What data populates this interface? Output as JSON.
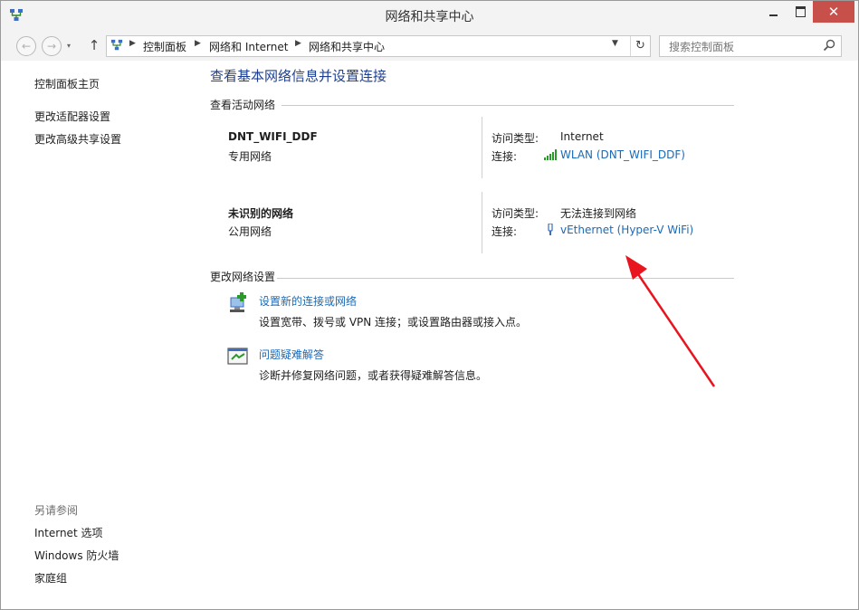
{
  "window": {
    "title": "网络和共享中心",
    "close_glyph": "✕"
  },
  "nav": {
    "back_glyph": "←",
    "forward_glyph": "→",
    "up_glyph": "↑",
    "breadcrumbs": [
      "控制面板",
      "网络和 Internet",
      "网络和共享中心"
    ],
    "search_placeholder": "搜索控制面板"
  },
  "sidebar": {
    "home": "控制面板主页",
    "links": [
      "更改适配器设置",
      "更改高级共享设置"
    ],
    "see_also_heading": "另请参阅",
    "see_also": [
      "Internet 选项",
      "Windows 防火墙",
      "家庭组"
    ]
  },
  "main": {
    "title": "查看基本网络信息并设置连接",
    "active_heading": "查看活动网络",
    "access_label": "访问类型:",
    "connection_label": "连接:",
    "networks": [
      {
        "name": "DNT_WIFI_DDF",
        "type": "专用网络",
        "access": "Internet",
        "connection": "WLAN (DNT_WIFI_DDF)",
        "icon": "wifi-signal-icon"
      },
      {
        "name": "未识别的网络",
        "type": "公用网络",
        "access": "无法连接到网络",
        "connection": "vEthernet (Hyper-V WiFi)",
        "icon": "ethernet-plug-icon"
      }
    ],
    "change_heading": "更改网络设置",
    "tasks": [
      {
        "link": "设置新的连接或网络",
        "desc": "设置宽带、拨号或 VPN 连接；或设置路由器或接入点。",
        "icon": "new-connection-icon"
      },
      {
        "link": "问题疑难解答",
        "desc": "诊断并修复网络问题，或者获得疑难解答信息。",
        "icon": "troubleshoot-icon"
      }
    ]
  },
  "colors": {
    "link": "#1a6ab8",
    "title": "#1e3f91",
    "close_button": "#c7504a",
    "annotation_arrow": "#e8141e"
  }
}
